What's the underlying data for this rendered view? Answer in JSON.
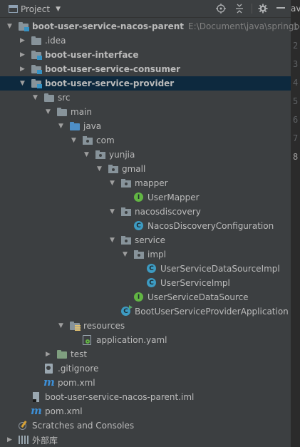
{
  "toolbar": {
    "view_label": "Project",
    "caret": "▼",
    "icons": [
      "project-icon",
      "locate-icon",
      "collapse-all-icon",
      "settings-gear-icon"
    ]
  },
  "editor": {
    "tab_fragment": "av",
    "line_numbers": [
      "1",
      "2",
      "3",
      "4",
      "5",
      "6",
      "7",
      "8"
    ]
  },
  "tree": [
    {
      "label": "boot-user-service-nacos-parent",
      "path": "E:\\Document\\java\\springboc",
      "bold": true,
      "expanded": true,
      "icon": "module-folder-icon"
    },
    {
      "label": ".idea",
      "expanded": false,
      "icon": "folder-icon"
    },
    {
      "label": "boot-user-interface",
      "bold": true,
      "expanded": false,
      "icon": "module-folder-icon"
    },
    {
      "label": "boot-user-service-consumer",
      "bold": true,
      "expanded": false,
      "icon": "module-folder-icon"
    },
    {
      "label": "boot-user-service-provider",
      "bold": true,
      "expanded": true,
      "selected": true,
      "icon": "module-folder-icon"
    },
    {
      "label": "src",
      "expanded": true,
      "icon": "folder-icon"
    },
    {
      "label": "main",
      "expanded": true,
      "icon": "folder-icon"
    },
    {
      "label": "java",
      "expanded": true,
      "icon": "source-folder-icon"
    },
    {
      "label": "com",
      "expanded": true,
      "icon": "package-icon"
    },
    {
      "label": "yunjia",
      "expanded": true,
      "icon": "package-icon"
    },
    {
      "label": "gmall",
      "expanded": true,
      "icon": "package-icon"
    },
    {
      "label": "mapper",
      "expanded": true,
      "icon": "package-icon"
    },
    {
      "label": "UserMapper",
      "icon": "interface-icon"
    },
    {
      "label": "nacosdiscovery",
      "expanded": true,
      "icon": "package-icon"
    },
    {
      "label": "NacosDiscoveryConfiguration",
      "icon": "class-icon"
    },
    {
      "label": "service",
      "expanded": true,
      "icon": "package-icon"
    },
    {
      "label": "impl",
      "expanded": true,
      "icon": "package-icon"
    },
    {
      "label": "UserServiceDataSourceImpl",
      "icon": "class-icon"
    },
    {
      "label": "UserServiceImpl",
      "icon": "class-icon"
    },
    {
      "label": "UserServiceDataSource",
      "icon": "interface-icon"
    },
    {
      "label": "BootUserServiceProviderApplication",
      "icon": "spring-boot-class-icon"
    },
    {
      "label": "resources",
      "expanded": true,
      "icon": "resources-folder-icon"
    },
    {
      "label": "application.yaml",
      "icon": "yaml-file-icon"
    },
    {
      "label": "test",
      "expanded": false,
      "icon": "test-folder-icon"
    },
    {
      "label": ".gitignore",
      "icon": "gitignore-file-icon"
    },
    {
      "label": "pom.xml",
      "icon": "maven-icon"
    },
    {
      "label": "boot-user-service-nacos-parent.iml",
      "icon": "iml-file-icon"
    },
    {
      "label": "pom.xml",
      "icon": "maven-icon"
    },
    {
      "label": "Scratches and Consoles",
      "icon": "scratches-icon"
    },
    {
      "label": "外部库",
      "expanded": false,
      "icon": "external-libraries-icon"
    }
  ]
}
